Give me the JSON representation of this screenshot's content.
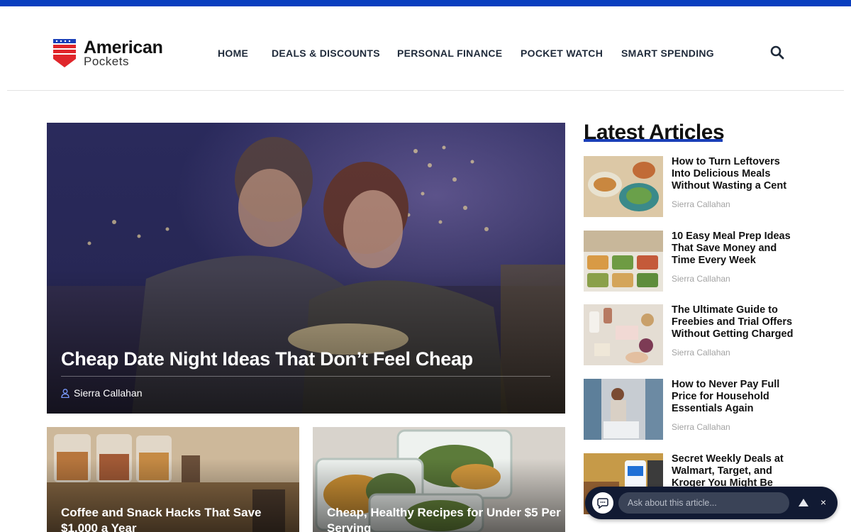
{
  "site": {
    "logo_name": "American",
    "logo_sub": "Pockets"
  },
  "nav": {
    "items": [
      {
        "label": "HOME"
      },
      {
        "label": "DEALS & DISCOUNTS"
      },
      {
        "label": "PERSONAL FINANCE"
      },
      {
        "label": "POCKET WATCH"
      },
      {
        "label": "SMART SPENDING"
      }
    ],
    "search_icon": "search-icon"
  },
  "hero": {
    "title": "Cheap Date Night Ideas That Don’t Feel Cheap",
    "author": "Sierra Callahan",
    "author_icon": "user-icon"
  },
  "cards": [
    {
      "title": "Coffee and Snack Hacks That Save $1,000 a Year"
    },
    {
      "title": "Cheap, Healthy Recipes for Under $5 Per Serving"
    }
  ],
  "sidebar": {
    "title": "Latest Articles",
    "articles": [
      {
        "title": "How to Turn Leftovers Into Delicious Meals Without Wasting a Cent",
        "author": "Sierra Callahan"
      },
      {
        "title": "10 Easy Meal Prep Ideas That Save Money and Time Every Week",
        "author": "Sierra Callahan"
      },
      {
        "title": "The Ultimate Guide to Freebies and Trial Offers Without Getting Charged",
        "author": "Sierra Callahan"
      },
      {
        "title": "How to Never Pay Full Price for Household Essentials Again",
        "author": "Sierra Callahan"
      },
      {
        "title": "Secret Weekly Deals at Walmart, Target, and Kroger You Might Be",
        "author": ""
      }
    ]
  },
  "chat": {
    "placeholder": "Ask about this article...",
    "close": "×"
  },
  "colors": {
    "brand_blue": "#0a3fbf",
    "flag_red": "#e0262b",
    "chat_bg": "#111a33"
  }
}
